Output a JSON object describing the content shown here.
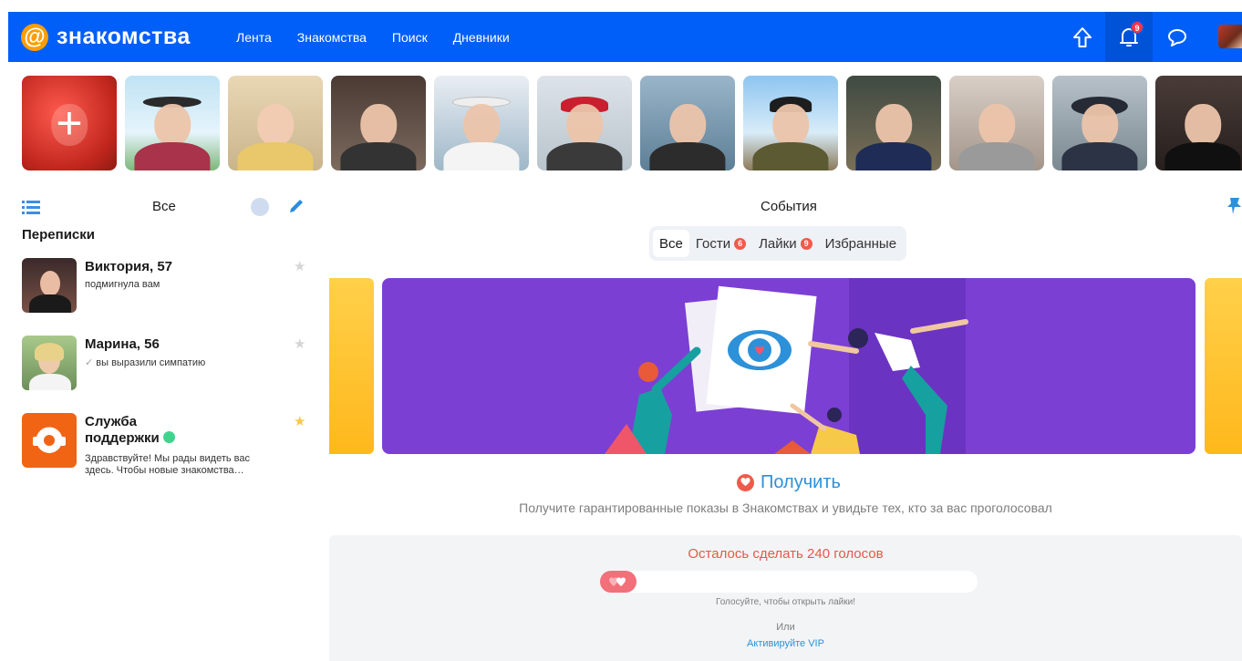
{
  "header": {
    "logo_symbol": "@",
    "logo_text": "знакомства",
    "nav": [
      "Лента",
      "Знакомства",
      "Поиск",
      "Дневники"
    ],
    "notifications_count": "9",
    "icons": [
      "arrow-up-icon",
      "notification-bell-icon",
      "chat-bubble-icon"
    ]
  },
  "stories": {
    "add_label": "+",
    "count": 12
  },
  "sidebar": {
    "filter_label": "Все",
    "section_title": "Переписки",
    "chats": [
      {
        "name": "Виктория, 57",
        "message": "подмигнула вам",
        "starred": false
      },
      {
        "name": "Марина, 56",
        "message": "вы выразили симпатию",
        "starred": false
      },
      {
        "name": "Служба поддержки",
        "message": "Здравствуйте! Мы рады видеть вас здесь. Чтобы новые знакомства…",
        "starred": true,
        "online": true
      }
    ]
  },
  "events": {
    "title": "События",
    "tabs": [
      {
        "label": "Все",
        "active": true
      },
      {
        "label": "Гости",
        "count": "6"
      },
      {
        "label": "Лайки",
        "count": "9"
      },
      {
        "label": "Избранные"
      }
    ]
  },
  "promo": {
    "get_label": "Получить",
    "description": "Получите гарантированные показы в Знакомствах и увидьте тех, кто за вас проголосовал"
  },
  "votes": {
    "remaining_text": "Осталось сделать 240 голосов",
    "progress_fraction": 0.09,
    "hint": "Голосуйте, чтобы открыть лайки!",
    "or_text": "Или",
    "vip_link": "Активируйте VIP"
  },
  "colors": {
    "header_bg": "#005ff9",
    "accent_blue": "#2c91d8",
    "banner_purple": "#7b3fd4",
    "vote_red": "#e5584a",
    "online_green": "#3fd48d",
    "star_gold": "#f7c948"
  }
}
